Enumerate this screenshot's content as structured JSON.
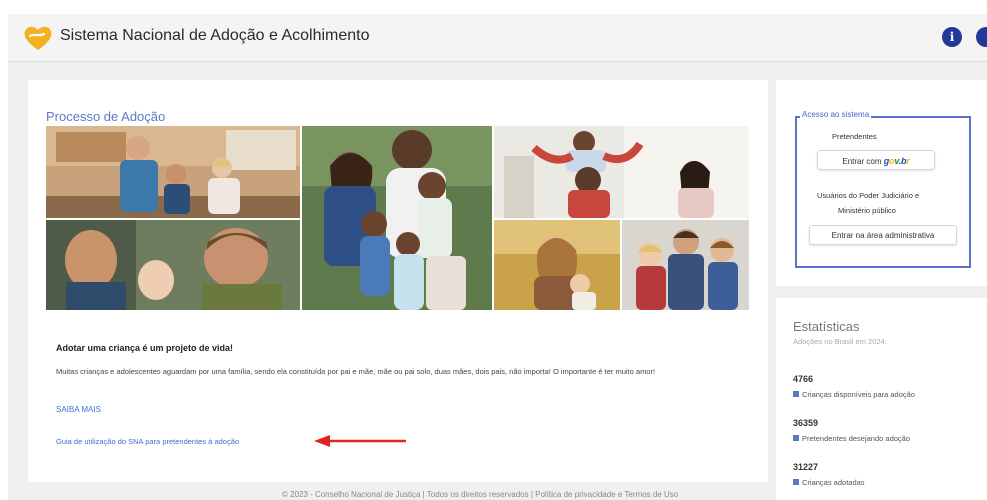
{
  "header": {
    "title": "Sistema Nacional de Adoção e Acolhimento",
    "logo_icon": "heart-logo-icon",
    "info_icon": "info-icon",
    "info_glyph": "i",
    "second_icon": "help-icon",
    "brand_color": "#f5b021"
  },
  "main": {
    "section_title": "Processo de Adoção",
    "tagline": "Adotar uma criança é um projeto de vida!",
    "description": "Muitas crianças e adolescentes aguardam por uma família, sendo ela constituída por pai e mãe, mãe ou pai solo, duas mães, dois pais, não importa! O importante é ter muito amor!",
    "saiba_mais": "SAIBA MAIS",
    "guide_link": "Guia de utilização do SNA para pretendentes à adoção",
    "arrow_color": "#e02424",
    "photos": [
      "photo-family-kitchen",
      "photo-father-baby",
      "photo-family-hug",
      "photo-kids-playing",
      "photo-mother-child-field",
      "photo-father-two-boys"
    ]
  },
  "access": {
    "legend": "Acesso ao sistema",
    "pretendentes_label": "Pretendentes",
    "govbr_prefix": "Entrar com",
    "govbr_logo": "gov.br",
    "judiciary_label_line1": "Usuários do Poder Judiciário e",
    "judiciary_label_line2": "Ministério público",
    "admin_button": "Entrar na área administrativa"
  },
  "stats": {
    "title": "Estatísticas",
    "subtitle": "Adoções no Brasil em 2024:",
    "items": [
      {
        "value": "4766",
        "label": "Crianças disponíveis para adoção"
      },
      {
        "value": "36359",
        "label": "Pretendentes desejando adoção"
      },
      {
        "value": "31227",
        "label": "Crianças adotadas"
      }
    ]
  },
  "footer": {
    "text": "© 2023 - Conselho Nacional de Justiça | Todos os direitos reservados | Política de privacidade e Termos de Uso"
  }
}
